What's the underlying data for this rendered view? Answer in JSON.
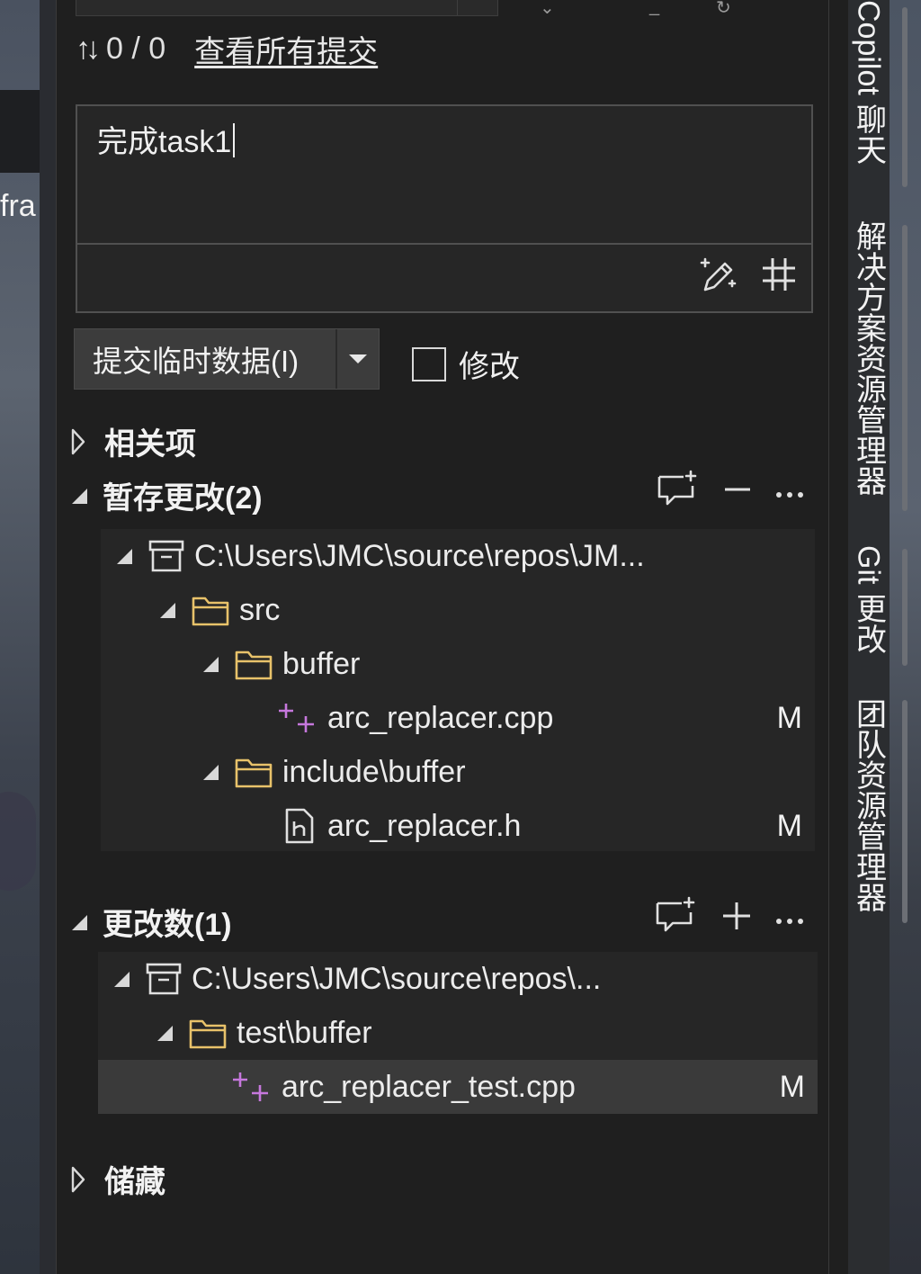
{
  "sync": {
    "arrows_icon": "sync-arrows-icon",
    "count": "0 / 0",
    "view_all_link": "查看所有提交"
  },
  "commit_message": {
    "text": "完成task1"
  },
  "commit_button": {
    "label": "提交临时数据(I)"
  },
  "amend": {
    "label": "修改",
    "checked": false
  },
  "sections": {
    "related": {
      "title": "相关项"
    },
    "staged": {
      "title": "暂存更改(2)",
      "repo_path": "C:\\Users\\JMC\\source\\repos\\JM...",
      "folder_src": "src",
      "folder_buffer": "buffer",
      "file_cpp": "arc_replacer.cpp",
      "file_cpp_status": "M",
      "folder_include": "include\\buffer",
      "file_h": "arc_replacer.h",
      "file_h_status": "M"
    },
    "changes": {
      "title": "更改数(1)",
      "repo_path": "C:\\Users\\JMC\\source\\repos\\...",
      "folder_test": "test\\buffer",
      "file_test": "arc_replacer_test.cpp",
      "file_test_status": "M"
    },
    "stashes": {
      "title": "储藏"
    }
  },
  "right_tabs": [
    "Copilot 聊天",
    "解决方案资源管理器",
    "Git 更改",
    "团队资源管理器"
  ],
  "background_fragment": "fra",
  "colors": {
    "folder": "#e8c26a",
    "added_icon": "#c678dd",
    "panel_bg": "#1f1f1f",
    "tree_bg": "#262626"
  }
}
